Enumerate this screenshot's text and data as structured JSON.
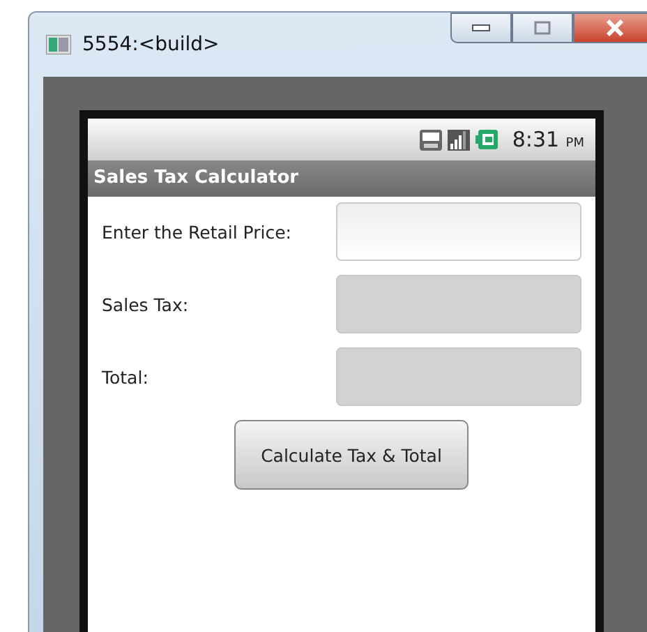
{
  "window": {
    "title": "5554:<build>"
  },
  "status_bar": {
    "time": "8:31",
    "meridiem": "PM"
  },
  "app": {
    "title": "Sales Tax Calculator"
  },
  "fields": [
    {
      "label": "Enter the Retail Price:",
      "disabled": false
    },
    {
      "label": "Sales Tax:",
      "disabled": true
    },
    {
      "label": "Total:",
      "disabled": true
    }
  ],
  "buttons": [
    "Calculate Tax & Total"
  ]
}
